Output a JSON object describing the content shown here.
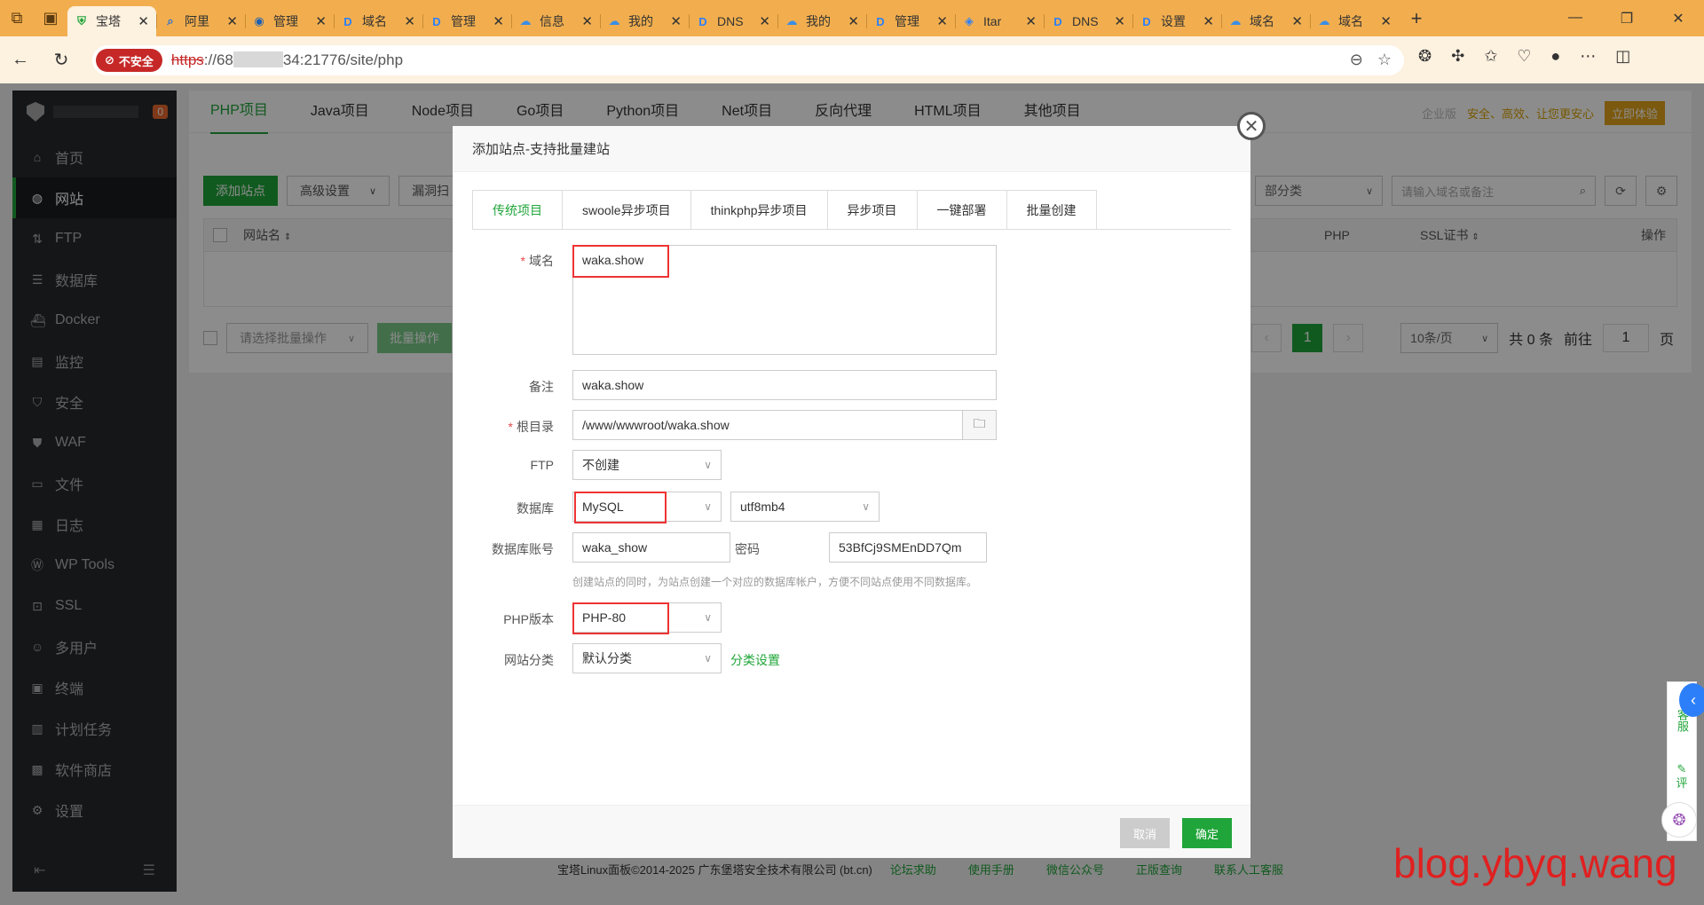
{
  "browser": {
    "tabs": [
      {
        "label": "宝塔",
        "icon": "bt-shield-icon",
        "active": true
      },
      {
        "label": "阿里",
        "icon": "search-icon"
      },
      {
        "label": "管理",
        "icon": "eye-icon"
      },
      {
        "label": "域名",
        "icon": "d-logo-icon"
      },
      {
        "label": "管理",
        "icon": "d-logo-icon"
      },
      {
        "label": "信息",
        "icon": "cloud-icon"
      },
      {
        "label": "我的",
        "icon": "cloud-icon"
      },
      {
        "label": "DNS",
        "icon": "d-logo-icon"
      },
      {
        "label": "我的",
        "icon": "cloud-icon"
      },
      {
        "label": "管理",
        "icon": "d-logo-icon"
      },
      {
        "label": "Itar",
        "icon": "itar-icon"
      },
      {
        "label": "DNS",
        "icon": "d-logo-icon"
      },
      {
        "label": "设置",
        "icon": "d-logo-icon"
      },
      {
        "label": "域名",
        "icon": "cloud-icon"
      },
      {
        "label": "域名",
        "icon": "cloud-icon"
      }
    ],
    "not_secure": "不安全",
    "url_scheme": "https",
    "url_host_start": "://68",
    "url_host_end": "34:21776/site/php"
  },
  "sidebar": {
    "badge": "0",
    "items": [
      {
        "label": "首页",
        "icon": "home-icon"
      },
      {
        "label": "网站",
        "icon": "globe-icon",
        "active": true
      },
      {
        "label": "FTP",
        "icon": "ftp-icon"
      },
      {
        "label": "数据库",
        "icon": "database-icon"
      },
      {
        "label": "Docker",
        "icon": "docker-icon"
      },
      {
        "label": "监控",
        "icon": "monitor-icon"
      },
      {
        "label": "安全",
        "icon": "shield-icon"
      },
      {
        "label": "WAF",
        "icon": "waf-icon"
      },
      {
        "label": "文件",
        "icon": "folder-icon"
      },
      {
        "label": "日志",
        "icon": "log-icon"
      },
      {
        "label": "WP Tools",
        "icon": "wordpress-icon"
      },
      {
        "label": "SSL",
        "icon": "ssl-icon"
      },
      {
        "label": "多用户",
        "icon": "users-icon"
      },
      {
        "label": "终端",
        "icon": "terminal-icon"
      },
      {
        "label": "计划任务",
        "icon": "calendar-icon"
      },
      {
        "label": "软件商店",
        "icon": "store-icon"
      },
      {
        "label": "设置",
        "icon": "gear-icon"
      }
    ]
  },
  "main": {
    "project_tabs": [
      "PHP项目",
      "Java项目",
      "Node项目",
      "Go项目",
      "Python项目",
      "Net项目",
      "反向代理",
      "HTML项目",
      "其他项目"
    ],
    "enterprise": {
      "version": "企业版",
      "slogan": "安全、高效、让您更安心",
      "try": "立即体验"
    },
    "toolbar": {
      "add_site": "添加站点",
      "advanced": "高级设置",
      "scan": "漏洞扫"
    },
    "category_select": "部分类",
    "search_placeholder": "请输入域名或备注",
    "table_headers": {
      "name": "网站名",
      "php": "PHP",
      "ssl": "SSL证书",
      "ops": "操作"
    },
    "batch_select": "请选择批量操作",
    "batch_btn": "批量操作",
    "pager": {
      "current": "1",
      "per_page": "10条/页",
      "total": "共 0 条",
      "goto": "前往",
      "page_input": "1",
      "page_unit": "页"
    },
    "footer": {
      "copyright": "宝塔Linux面板©2014-2025 广东堡塔安全技术有限公司 (bt.cn)",
      "links": [
        "论坛求助",
        "使用手册",
        "微信公众号",
        "正版查询",
        "联系人工客服"
      ]
    }
  },
  "modal": {
    "title": "添加站点-支持批量建站",
    "tabs": [
      "传统项目",
      "swoole异步项目",
      "thinkphp异步项目",
      "异步项目",
      "一键部署",
      "批量创建"
    ],
    "fields": {
      "domain_label": "域名",
      "domain_value": "waka.show",
      "remark_label": "备注",
      "remark_value": "waka.show",
      "root_label": "根目录",
      "root_value": "/www/wwwroot/waka.show",
      "ftp_label": "FTP",
      "ftp_value": "不创建",
      "db_label": "数据库",
      "db_value": "MySQL",
      "charset_value": "utf8mb4",
      "db_user_label": "数据库账号",
      "db_user_value": "waka_show",
      "pwd_label": "密码",
      "pwd_value": "53BfCj9SMEnDD7Qm",
      "db_hint": "创建站点的同时，为站点创建一个对应的数据库帐户，方便不同站点使用不同数据库。",
      "php_label": "PHP版本",
      "php_value": "PHP-80",
      "cat_label": "网站分类",
      "cat_value": "默认分类",
      "cat_link": "分类设置"
    },
    "cancel": "取消",
    "confirm": "确定"
  },
  "float": {
    "service": "客服",
    "review": "评"
  },
  "watermark": "blog.ybyq.wang"
}
